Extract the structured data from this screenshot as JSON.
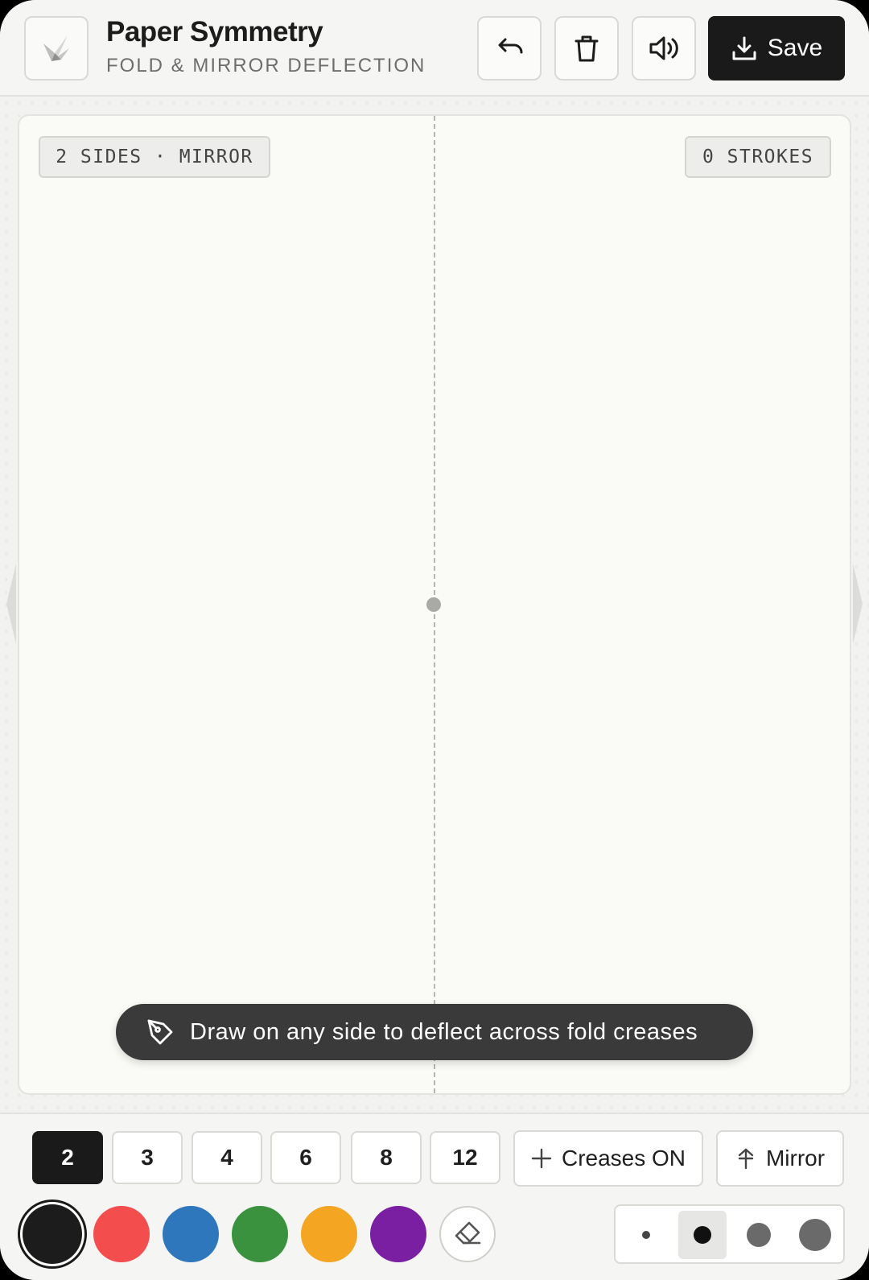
{
  "header": {
    "title": "Paper Symmetry",
    "subtitle": "FOLD & MIRROR DEFLECTION",
    "logo_icon": "paper-crane-icon",
    "save_label": "Save"
  },
  "canvas": {
    "mode_chip": "2 SIDES · MIRROR",
    "stroke_chip": "0 STROKES",
    "hint": "Draw on any side to deflect across fold creases"
  },
  "sides": {
    "options": [
      "2",
      "3",
      "4",
      "6",
      "8",
      "12"
    ],
    "selected": "2"
  },
  "toggles": {
    "creases_label": "Creases ON",
    "mirror_label": "Mirror"
  },
  "colors": {
    "swatches": [
      "#1c1c1c",
      "#f44d4d",
      "#2f77bd",
      "#3a923e",
      "#f4a623",
      "#7b1fa2"
    ],
    "selected": "#1c1c1c"
  },
  "brush_sizes": {
    "count": 4,
    "selected_index": 1
  }
}
